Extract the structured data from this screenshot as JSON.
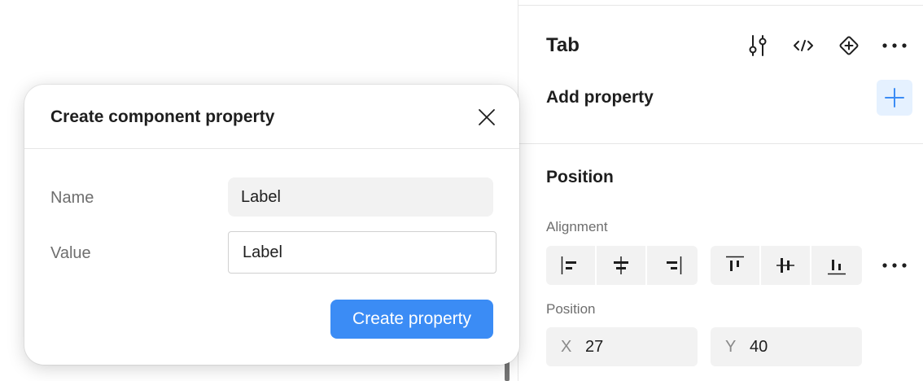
{
  "panel": {
    "title": "Tab",
    "header_icons": [
      "adjust-sliders-icon",
      "code-icon",
      "component-add-icon",
      "more-icon"
    ],
    "add_property_label": "Add property",
    "position_section_title": "Position",
    "alignment_label": "Alignment",
    "position_label": "Position",
    "x_axis": "X",
    "x_value": "27",
    "y_axis": "Y",
    "y_value": "40"
  },
  "dialog": {
    "title": "Create component property",
    "name_label": "Name",
    "name_value": "Label",
    "value_label": "Value",
    "value_value": "Label",
    "create_button": "Create property"
  },
  "colors": {
    "accent": "#3b8cf5",
    "accent_light": "#e5f1ff",
    "field_bg": "#f2f2f2"
  }
}
